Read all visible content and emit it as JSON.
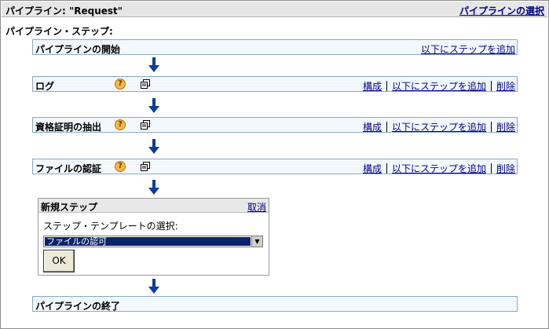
{
  "header": {
    "title": "パイプライン: \"Request\"",
    "select_pipeline_link": "パイプラインの選択"
  },
  "steps_heading": "パイプライン・ステップ:",
  "start_step": {
    "label": "パイプラインの開始",
    "add_below": "以下にステップを追加"
  },
  "steps": [
    {
      "label": "ログ",
      "configure": "構成",
      "add_below": "以下にステップを追加",
      "delete": "削除"
    },
    {
      "label": "資格証明の抽出",
      "configure": "構成",
      "add_below": "以下にステップを追加",
      "delete": "削除"
    },
    {
      "label": "ファイルの認証",
      "configure": "構成",
      "add_below": "以下にステップを追加",
      "delete": "削除"
    }
  ],
  "new_step_panel": {
    "title": "新規ステップ",
    "cancel": "取消",
    "template_label": "ステップ・テンプレートの選択:",
    "selected_template": "ファイルの認可",
    "ok_label": "OK"
  },
  "end_step": {
    "label": "パイプラインの終了"
  },
  "colors": {
    "link": "#00008b",
    "arrow": "#0c3c9c",
    "bar_border": "#87a9cf",
    "bar_fill": "#edf5fd",
    "help_icon": "#f8b74a"
  }
}
